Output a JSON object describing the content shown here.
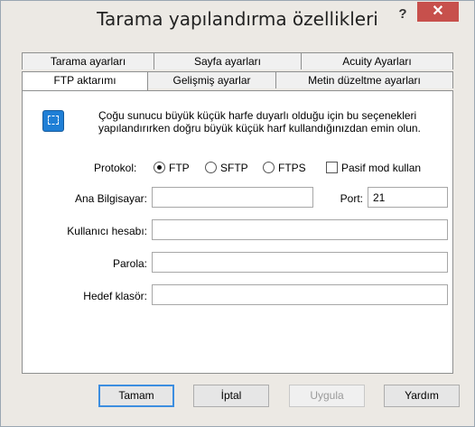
{
  "window": {
    "title": "Tarama yapılandırma özellikleri",
    "help_label": "?",
    "close_label": "✕"
  },
  "tabs": {
    "row1": [
      "Tarama ayarları",
      "Sayfa ayarları",
      "Acuity Ayarları"
    ],
    "row2": [
      "FTP aktarımı",
      "Gelişmiş ayarlar",
      "Metin düzeltme ayarları"
    ],
    "active": "FTP aktarımı"
  },
  "info": {
    "icon": "ftp-icon",
    "text": "Çoğu sunucu büyük küçük harfe duyarlı olduğu için bu seçenekleri yapılandırırken doğru büyük küçük harf kullandığınızdan emin olun."
  },
  "protocol": {
    "label": "Protokol:",
    "options": [
      "FTP",
      "SFTP",
      "FTPS"
    ],
    "selected": "FTP",
    "passive_label": "Pasif mod kullan",
    "passive_checked": false
  },
  "fields": {
    "host_label": "Ana Bilgisayar:",
    "host_value": "",
    "port_label": "Port:",
    "port_value": "21",
    "user_label": "Kullanıcı hesabı:",
    "user_value": "",
    "password_label": "Parola:",
    "password_value": "",
    "folder_label": "Hedef klasör:",
    "folder_value": ""
  },
  "buttons": {
    "ok": "Tamam",
    "cancel": "İptal",
    "apply": "Uygula",
    "help": "Yardım"
  }
}
